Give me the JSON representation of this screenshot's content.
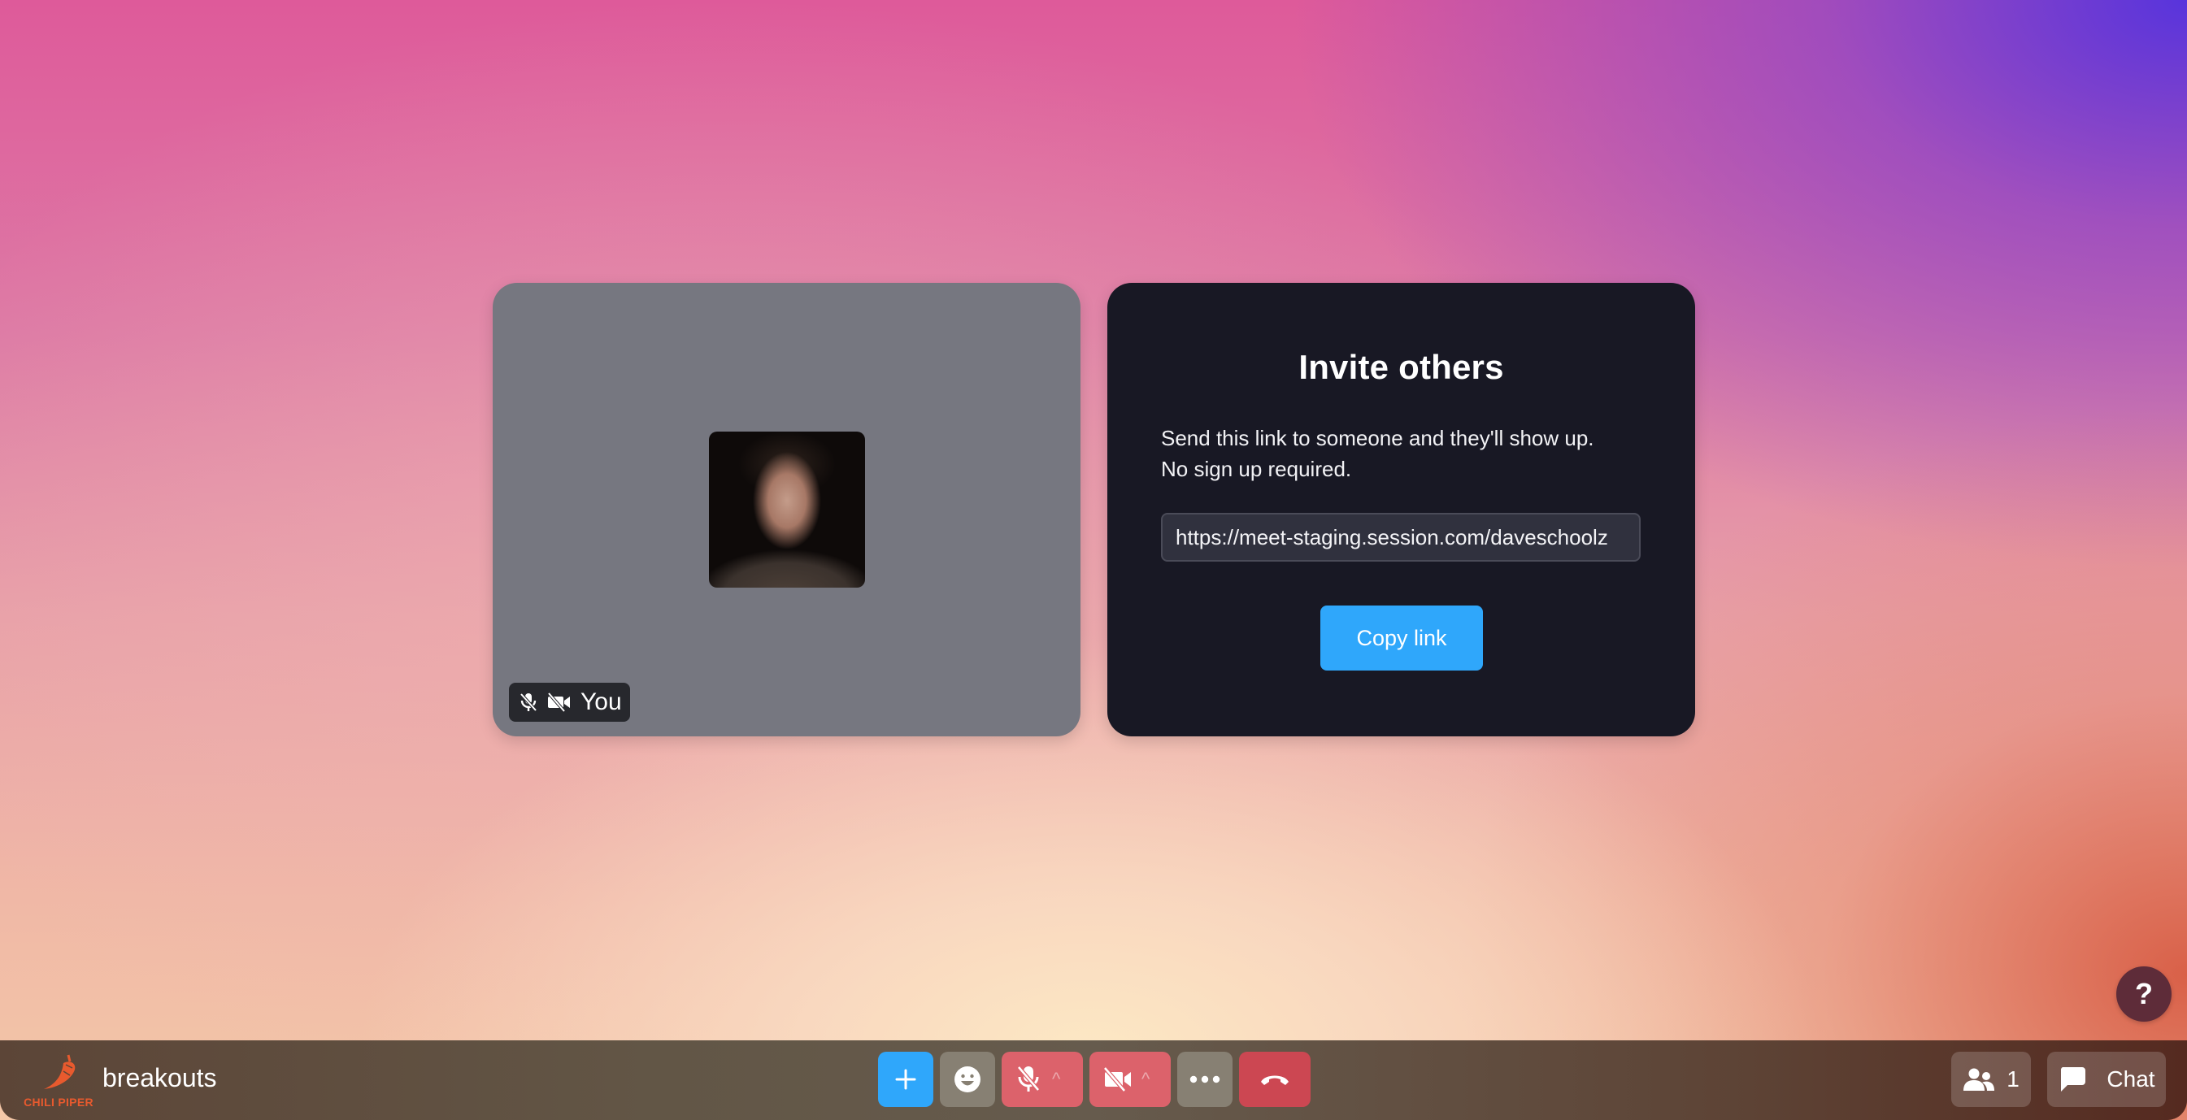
{
  "self_tile": {
    "participant_label": "You",
    "mic_status_icon": "mic-off-icon",
    "camera_status_icon": "camera-off-icon"
  },
  "invite": {
    "title": "Invite others",
    "description_line1": "Send this link to someone and they'll show up.",
    "description_line2": "No sign up required.",
    "link_value": "https://meet-staging.session.com/daveschoolz",
    "copy_button_label": "Copy link"
  },
  "help": {
    "label": "?"
  },
  "bottom_bar": {
    "brand_name": "CHILI PIPER",
    "room_name": "breakouts",
    "controls": {
      "add_icon": "plus-icon",
      "emoji_icon": "smiley-icon",
      "mic_icon": "mic-off-icon",
      "camera_icon": "camera-off-icon",
      "more_icon": "ellipsis-icon",
      "leave_icon": "phone-hangup-icon",
      "caret": "^"
    },
    "people_count": "1",
    "chat_label": "Chat"
  },
  "colors": {
    "accent_blue": "#2fa7fb",
    "muted_red": "#dc626b",
    "leave_red": "#cc4752",
    "invite_card_bg": "#181824",
    "self_tile_bg": "#767780",
    "brand_orange": "#e85a2e",
    "help_bg": "#5e2c39"
  }
}
